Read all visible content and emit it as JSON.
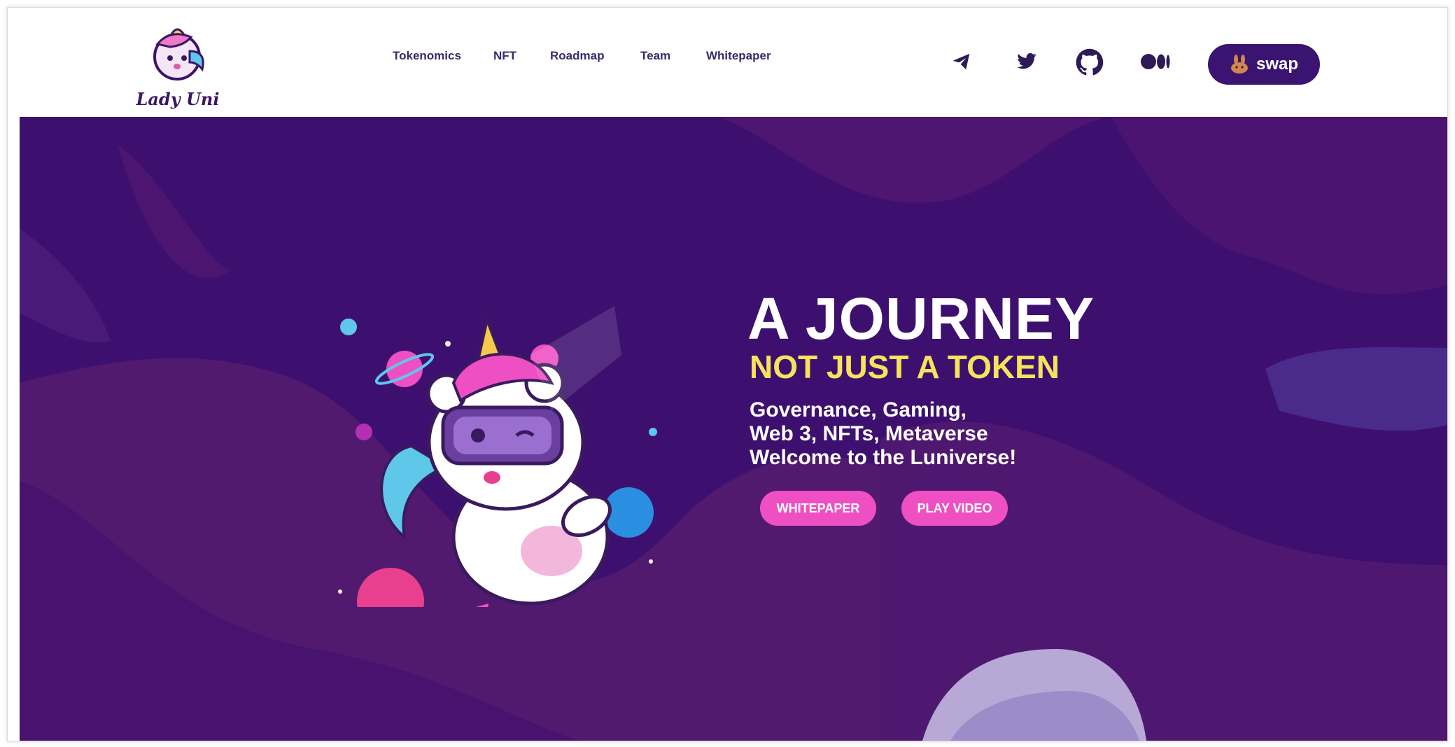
{
  "brand": {
    "name": "Lady Uni"
  },
  "nav": {
    "items": [
      "Tokenomics",
      "NFT",
      "Roadmap",
      "Team",
      "Whitepaper"
    ]
  },
  "social": {
    "icons": [
      "telegram-icon",
      "twitter-icon",
      "github-icon",
      "medium-icon"
    ]
  },
  "swap": {
    "label": "swap",
    "icon": "pancake-bunny-icon"
  },
  "hero": {
    "headline": "A JOURNEY",
    "subheadline": "NOT JUST A TOKEN",
    "description": [
      "Governance, Gaming,",
      "Web 3, NFTs, Metaverse",
      "Welcome to the Luniverse!"
    ],
    "buttons": {
      "whitepaper": "WHITEPAPER",
      "play_video": "PLAY VIDEO"
    }
  },
  "colors": {
    "brand_purple": "#3a1470",
    "hero_bg": "#3d1070",
    "accent_yellow": "#f7e35b",
    "accent_pink": "#ee4fc3",
    "nav_text": "#3a2b6b"
  }
}
